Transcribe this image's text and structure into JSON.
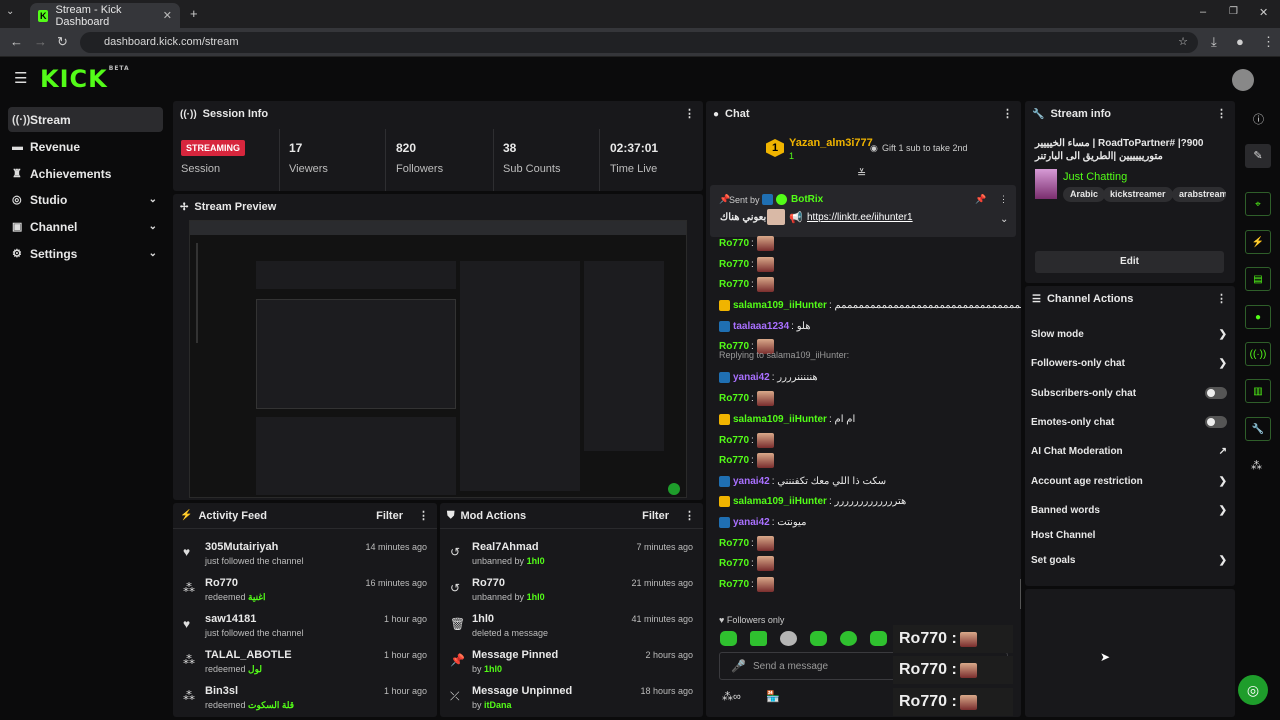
{
  "browser": {
    "tab_title": "Stream - Kick Dashboard",
    "url": "dashboard.kick.com/stream"
  },
  "app": {
    "logo": "KICK",
    "logo_badge": "BETA"
  },
  "sidebar": {
    "items": [
      {
        "label": "Stream",
        "icon": "broadcast-icon"
      },
      {
        "label": "Revenue",
        "icon": "money-icon"
      },
      {
        "label": "Achievements",
        "icon": "trophy-icon"
      },
      {
        "label": "Studio",
        "icon": "studio-icon"
      },
      {
        "label": "Channel",
        "icon": "channel-icon"
      },
      {
        "label": "Settings",
        "icon": "gear-icon"
      }
    ]
  },
  "session": {
    "title": "Session Info",
    "status": "STREAMING",
    "status_label": "Session",
    "stats": [
      {
        "value": "17",
        "label": "Viewers"
      },
      {
        "value": "820",
        "label": "Followers"
      },
      {
        "value": "38",
        "label": "Sub Counts"
      },
      {
        "value": "02:37:01",
        "label": "Time Live"
      }
    ]
  },
  "preview": {
    "title": "Stream Preview"
  },
  "activity": {
    "title": "Activity Feed",
    "filter": "Filter",
    "items": [
      {
        "name": "305Mutairiyah",
        "sub": "just followed the channel",
        "reward": "",
        "time": "14 minutes ago",
        "icon": "heart-icon"
      },
      {
        "name": "Ro770",
        "sub": "redeemed",
        "reward": "اغنية",
        "time": "16 minutes ago",
        "icon": "points-icon"
      },
      {
        "name": "saw14181",
        "sub": "just followed the channel",
        "reward": "",
        "time": "1 hour ago",
        "icon": "heart-icon"
      },
      {
        "name": "TALAL_ABOTLE",
        "sub": "redeemed",
        "reward": "لول",
        "time": "1 hour ago",
        "icon": "points-icon"
      },
      {
        "name": "Bin3sl",
        "sub": "redeemed",
        "reward": "قلة السكوت",
        "time": "1 hour ago",
        "icon": "points-icon"
      }
    ]
  },
  "mod": {
    "title": "Mod Actions",
    "filter": "Filter",
    "items": [
      {
        "name": "Real7Ahmad",
        "sub": "unbanned by",
        "by": "1hl0",
        "time": "7 minutes ago",
        "icon": "unban-icon"
      },
      {
        "name": "Ro770",
        "sub": "unbanned by",
        "by": "1hl0",
        "time": "21 minutes ago",
        "icon": "unban-icon"
      },
      {
        "name": "1hl0",
        "sub": "deleted a message",
        "by": "",
        "time": "41 minutes ago",
        "icon": "trash-icon"
      },
      {
        "name": "Message Pinned",
        "sub": "by",
        "by": "1hl0",
        "time": "2 hours ago",
        "icon": "pin-icon"
      },
      {
        "name": "Message Unpinned",
        "sub": "by",
        "by": "itDana",
        "time": "18 hours ago",
        "icon": "unpin-icon"
      }
    ]
  },
  "chat": {
    "title": "Chat",
    "gifter": {
      "rank": "1",
      "name": "Yazan_alm3i777",
      "count": "1",
      "cta": "Gift 1 sub to take 2nd"
    },
    "pinned": {
      "sent_by": "Sent by",
      "bot": "BotRix",
      "text": "تابعوني هناك",
      "link": "https://linktr.ee/iihunter1"
    },
    "reply_to": "Replying to salama109_iiHunter:",
    "messages": [
      {
        "user": "Ro770",
        "text": "",
        "cls": "uname"
      },
      {
        "user": "Ro770",
        "text": "",
        "cls": "uname"
      },
      {
        "user": "Ro770",
        "text": "",
        "cls": "uname"
      },
      {
        "user": "salama109_iiHunter",
        "text": ": ممممممممممممممممممممممممممممممممممم",
        "cls": "uname"
      },
      {
        "user": "taalaaa1234",
        "text": ": هلو",
        "cls": "uname p"
      },
      {
        "user": "Ro770",
        "text": "",
        "cls": "uname"
      },
      {
        "user": "yanai42",
        "text": ": هنننننرررر",
        "cls": "uname p"
      },
      {
        "user": "Ro770",
        "text": "",
        "cls": "uname"
      },
      {
        "user": "salama109_iiHunter",
        "text": ": ام ام",
        "cls": "uname"
      },
      {
        "user": "Ro770",
        "text": "",
        "cls": "uname"
      },
      {
        "user": "Ro770",
        "text": "",
        "cls": "uname"
      },
      {
        "user": "yanai42",
        "text": ": سكت ذا اللي معك تكفننني",
        "cls": "uname p"
      },
      {
        "user": "salama109_iiHunter",
        "text": ": هتررررررررررررر",
        "cls": "uname"
      },
      {
        "user": "yanai42",
        "text": ": ميونتت",
        "cls": "uname p"
      },
      {
        "user": "Ro770",
        "text": "",
        "cls": "uname"
      },
      {
        "user": "Ro770",
        "text": "",
        "cls": "uname"
      },
      {
        "user": "Ro770",
        "text": "",
        "cls": "uname"
      }
    ],
    "followers_only": "Followers only",
    "placeholder": "Send a message",
    "overlay": [
      "Ro770 :",
      "Ro770 :",
      "Ro770 :"
    ]
  },
  "stream_info": {
    "title": "Stream info",
    "stream_title": "900?| #RoadToPartner | مساء الخيييير متوريييييين |الطريق الى البارتنر",
    "category": "Just Chatting",
    "tags": [
      "Arabic",
      "kickstreamer",
      "arabstreame"
    ],
    "edit": "Edit"
  },
  "channel_actions": {
    "title": "Channel Actions",
    "items": [
      {
        "label": "Slow mode",
        "ctrl": "arrow"
      },
      {
        "label": "Followers-only chat",
        "ctrl": "arrow"
      },
      {
        "label": "Subscribers-only chat",
        "ctrl": "toggle"
      },
      {
        "label": "Emotes-only chat",
        "ctrl": "toggle"
      },
      {
        "label": "AI Chat Moderation",
        "ctrl": "external"
      },
      {
        "label": "Account age restriction",
        "ctrl": "arrow"
      },
      {
        "label": "Banned words",
        "ctrl": "arrow"
      },
      {
        "label": "Host Channel",
        "ctrl": "none"
      },
      {
        "label": "Set goals",
        "ctrl": "arrow"
      }
    ]
  },
  "colors": {
    "accent": "#53fc18",
    "live": "#d7263d",
    "panel": "#18181b"
  }
}
